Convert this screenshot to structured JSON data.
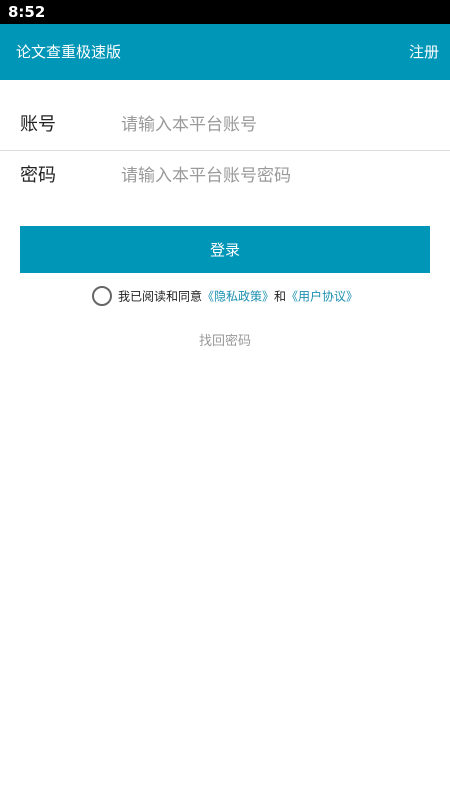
{
  "status_bar": {
    "time": "8:52"
  },
  "app_bar": {
    "title": "论文查重极速版",
    "register_label": "注册"
  },
  "form": {
    "account_label": "账号",
    "account_placeholder": "请输入本平台账号",
    "account_value": "",
    "password_label": "密码",
    "password_placeholder": "请输入本平台账号密码",
    "password_value": ""
  },
  "login_button_label": "登录",
  "agreement": {
    "checked": false,
    "prefix": "我已阅读和同意",
    "privacy_link": "《隐私政策》",
    "connector": "和",
    "terms_link": "《用户协议》"
  },
  "forgot_password_label": "找回密码",
  "colors": {
    "accent": "#0096b8",
    "link": "#1a8fb0",
    "status_bar": "#000000",
    "placeholder": "#9a9a9a",
    "muted_text": "#999999"
  }
}
